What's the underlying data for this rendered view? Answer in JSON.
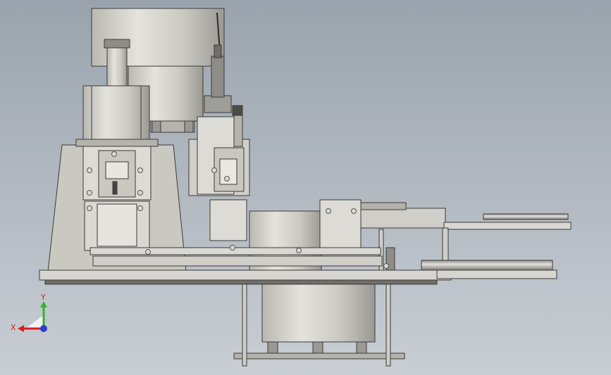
{
  "viewport": {
    "background_top": "#9aa3ad",
    "background_bottom": "#c9ced4"
  },
  "colors": {
    "metal_light": "#d9d8d2",
    "metal_mid": "#c2c1ba",
    "metal_dark": "#8e8d87",
    "edge": "#3b3b39",
    "shadow": "#6f6e69",
    "bolt": "#555552"
  },
  "triad": {
    "y_label": "Y",
    "x_label": "X",
    "y_color": "#2fb52f",
    "x_color": "#d81e1e",
    "z_color": "#2a3fd0"
  }
}
